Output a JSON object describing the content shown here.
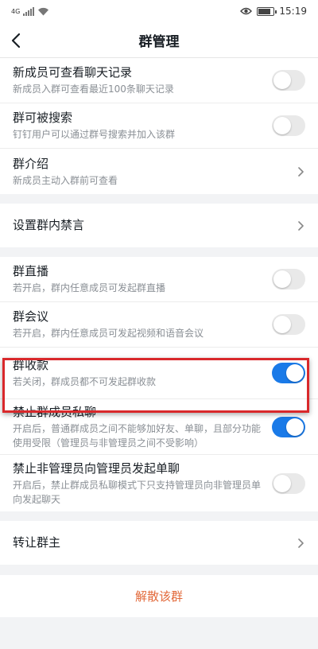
{
  "statusbar": {
    "network": "4G",
    "time": "15:19"
  },
  "navbar": {
    "title": "群管理"
  },
  "groups": [
    [
      {
        "title": "新成员可查看聊天记录",
        "subtitle": "新成员入群可查看最近100条聊天记录",
        "control": "toggle",
        "on": false
      },
      {
        "title": "群可被搜索",
        "subtitle": "钉钉用户可以通过群号搜索并加入该群",
        "control": "toggle",
        "on": false
      },
      {
        "title": "群介绍",
        "subtitle": "新成员主动入群前可查看",
        "control": "chevron"
      }
    ],
    [
      {
        "title": "设置群内禁言",
        "control": "chevron"
      }
    ],
    [
      {
        "title": "群直播",
        "subtitle": "若开启，群内任意成员可发起群直播",
        "control": "toggle",
        "on": false
      },
      {
        "title": "群会议",
        "subtitle": "若开启，群内任意成员可发起视频和语音会议",
        "control": "toggle",
        "on": false
      },
      {
        "title": "群收款",
        "subtitle": "若关闭，群成员都不可发起群收款",
        "control": "toggle",
        "on": true
      },
      {
        "title": "禁止群成员私聊",
        "subtitle": "开启后，普通群成员之间不能够加好友、单聊，且部分功能使用受限（管理员与非管理员之间不受影响）",
        "control": "toggle",
        "on": true
      },
      {
        "title": "禁止非管理员向管理员发起单聊",
        "subtitle": "开启后，禁止群成员私聊模式下只支持管理员向非管理员单向发起聊天",
        "control": "toggle",
        "on": false
      }
    ],
    [
      {
        "title": "转让群主",
        "control": "chevron"
      }
    ]
  ],
  "disband": {
    "label": "解散该群"
  },
  "colors": {
    "accent": "#1a7ae8",
    "danger": "#e2693a",
    "highlight": "#d9282b"
  }
}
